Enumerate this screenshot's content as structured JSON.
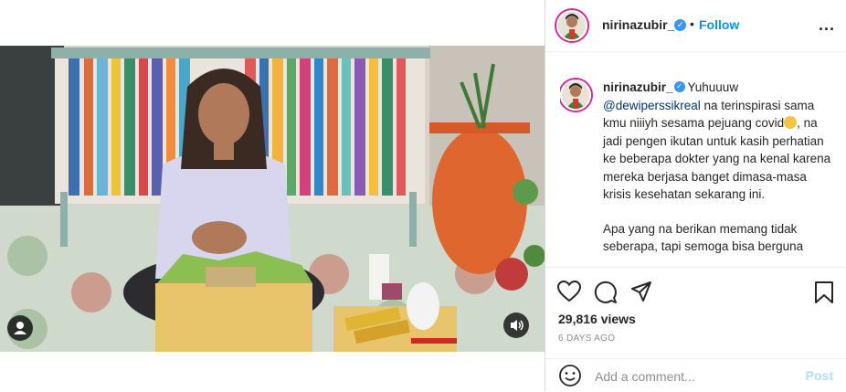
{
  "post": {
    "username": "nirinazubir_",
    "verified_icon": "verified-badge-icon",
    "dot": "•",
    "follow_label": "Follow",
    "more_icon": "more-options-icon",
    "more_label": "..."
  },
  "caption": {
    "username": "nirinazubir_",
    "line1_after_user": "Yuhuuuw",
    "mention": "@dewiperssikreal",
    "text1": " na terinspirasi sama kmu niiiyh sesama pejuang covid",
    "text2": ", na jadi pengen ikutan untuk kasih perhatian ke beberapa dokter yang na kenal karena mereka berjasa banget dimasa-masa krisis kesehatan sekarang ini.",
    "para2": "Apa yang na berikan memang tidak seberapa, tapi semoga bisa berguna"
  },
  "stats": {
    "views": "29,816 views",
    "time_ago": "6 DAYS AGO"
  },
  "comment": {
    "placeholder": "Add a comment...",
    "post_label": "Post"
  },
  "icons": {
    "like": "heart-icon",
    "comment": "comment-icon",
    "share": "share-icon",
    "save": "bookmark-icon",
    "emoji": "emoji-icon",
    "user_tag": "user-tag-icon",
    "sound": "speaker-icon"
  },
  "colors": {
    "accent": "#0095f6",
    "verified": "#3897f0",
    "muted": "#8e8e8e"
  }
}
